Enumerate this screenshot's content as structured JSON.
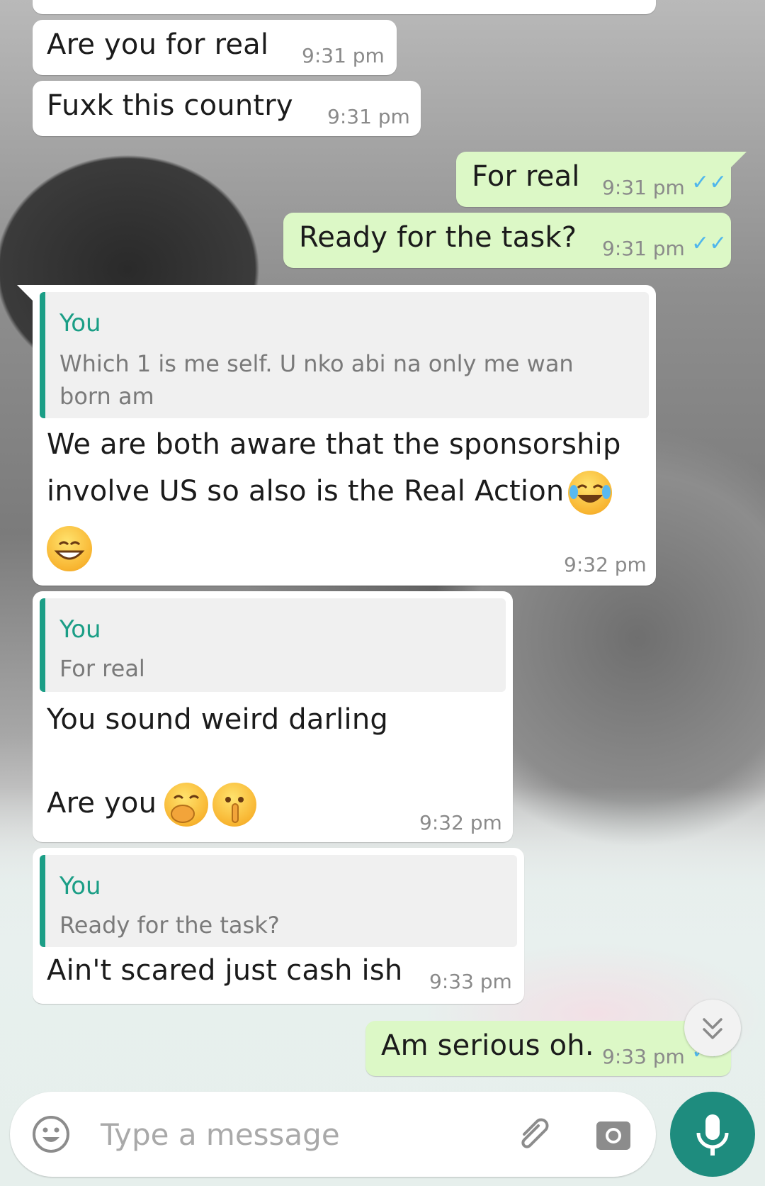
{
  "messages": [
    {
      "id": "m1",
      "dir": "in",
      "text": "Are you for real",
      "time": "9:31 pm"
    },
    {
      "id": "m2",
      "dir": "in",
      "text": "Fuxk this country",
      "time": "9:31 pm"
    },
    {
      "id": "m3",
      "dir": "out",
      "text": "For real",
      "time": "9:31 pm",
      "status": "read"
    },
    {
      "id": "m4",
      "dir": "out",
      "text": "Ready for the task?",
      "time": "9:31 pm",
      "status": "read"
    },
    {
      "id": "m5",
      "dir": "in",
      "reply": {
        "author": "You",
        "line1": "Which 1 is me self. U nko abi na only me wan",
        "line2": "born am"
      },
      "line1": "We are both aware that the sponsorship",
      "line2": "involve US so also is the Real Action",
      "time": "9:32 pm",
      "emojis": [
        "tears-of-joy-emoji",
        "grinning-emoji"
      ]
    },
    {
      "id": "m6",
      "dir": "in",
      "reply": {
        "author": "You",
        "text": "For real"
      },
      "line1": "You sound weird darling",
      "line2": "Are you",
      "time": "9:32 pm",
      "emojis": [
        "hand-over-mouth-emoji",
        "shushing-emoji"
      ]
    },
    {
      "id": "m7",
      "dir": "in",
      "reply": {
        "author": "You",
        "text": "Ready for the task?"
      },
      "text": "Ain't scared just cash ish",
      "time": "9:33 pm"
    },
    {
      "id": "m8",
      "dir": "out",
      "text": "Am serious oh.",
      "time": "9:33 pm",
      "status": "read"
    }
  ],
  "composer": {
    "placeholder": "Type a message"
  },
  "icons": {
    "emoji": "emoji-icon",
    "attach": "paperclip-icon",
    "camera": "camera-icon",
    "mic": "mic-icon",
    "scroll": "chevron-double-down-icon",
    "read": "double-check-icon"
  },
  "colors": {
    "outgoing": "#dcf8c6",
    "incoming": "#ffffff",
    "accent": "#1e8c7e",
    "quote_bar": "#1b9e86",
    "read_ticks": "#4fb6ec"
  }
}
